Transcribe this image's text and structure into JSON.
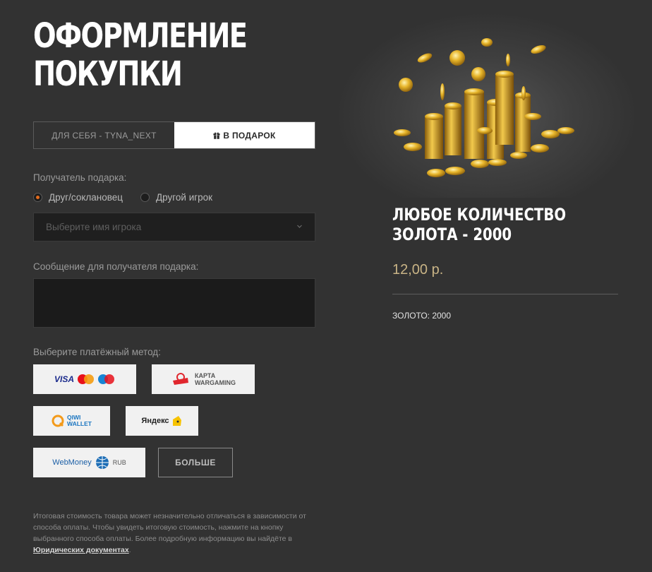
{
  "page": {
    "title_line1": "ОФОРМЛЕНИЕ",
    "title_line2": "ПОКУПКИ"
  },
  "tabs": [
    {
      "label": "ДЛЯ СЕБЯ - TYNA_NEXT",
      "active": false
    },
    {
      "label": "В ПОДАРОК",
      "active": true,
      "icon": "gift-icon"
    }
  ],
  "recipient": {
    "label": "Получатель подарка:",
    "options": [
      {
        "label": "Друг/соклановец",
        "checked": true
      },
      {
        "label": "Другой игрок",
        "checked": false
      }
    ],
    "select_placeholder": "Выберите имя игрока"
  },
  "message": {
    "label": "Сообщение для получателя подарка:",
    "value": ""
  },
  "payment": {
    "label": "Выберите платёжный метод:",
    "methods": [
      {
        "name": "visa-mastercard-maestro",
        "text": "VISA"
      },
      {
        "name": "wargaming-card",
        "text_line1": "КАРТА",
        "text_line2": "WARGAMING"
      },
      {
        "name": "qiwi-wallet",
        "text_line1": "QIWI",
        "text_line2": "WALLET"
      },
      {
        "name": "yandex-money",
        "text": "Яндекс"
      },
      {
        "name": "webmoney",
        "text": "WebMoney",
        "currency": "RUB"
      }
    ],
    "more_label": "БОЛЬШЕ"
  },
  "footnote": {
    "text": "Итоговая стоимость товара может незначительно отличаться в зависимости от способа оплаты. Чтобы увидеть итоговую стоимость, нажмите на кнопку выбранного способа оплаты. Более подробную информацию вы найдёте в ",
    "link": "Юридических документах",
    "end": "."
  },
  "product": {
    "title": "ЛЮБОЕ КОЛИЧЕСТВО ЗОЛОТА - 2000",
    "price": "12,00 р.",
    "spec": "ЗОЛОТО: 2000",
    "image": "gold-coins-image"
  },
  "colors": {
    "background": "#323232",
    "accent_radio": "#e36b1d",
    "price": "#c9b486"
  }
}
